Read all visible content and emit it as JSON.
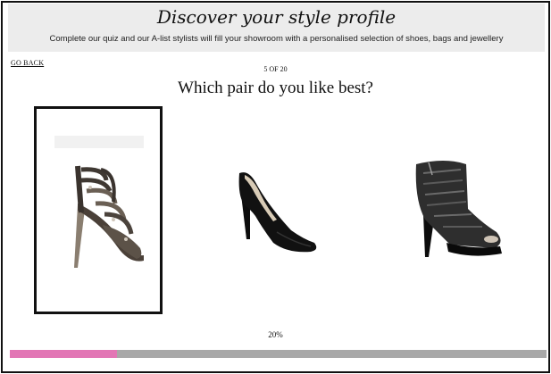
{
  "header": {
    "title": "Discover your style profile",
    "subtitle": "Complete our quiz and our A-list stylists will fill your showroom with a personalised selection of shoes, bags and jewellery"
  },
  "nav": {
    "go_back": "GO BACK"
  },
  "quiz": {
    "step": "5 OF 20",
    "question": "Which pair do you like best?",
    "options": [
      {
        "icon": "strappy-glitter-sandal-icon",
        "selected": true
      },
      {
        "icon": "black-suede-pump-icon",
        "selected": false
      },
      {
        "icon": "black-peep-toe-bootie-icon",
        "selected": false
      }
    ]
  },
  "progress": {
    "label": "20%",
    "value": 0.2,
    "fill_color": "#e276b5",
    "track_color": "#a8a8a8"
  }
}
